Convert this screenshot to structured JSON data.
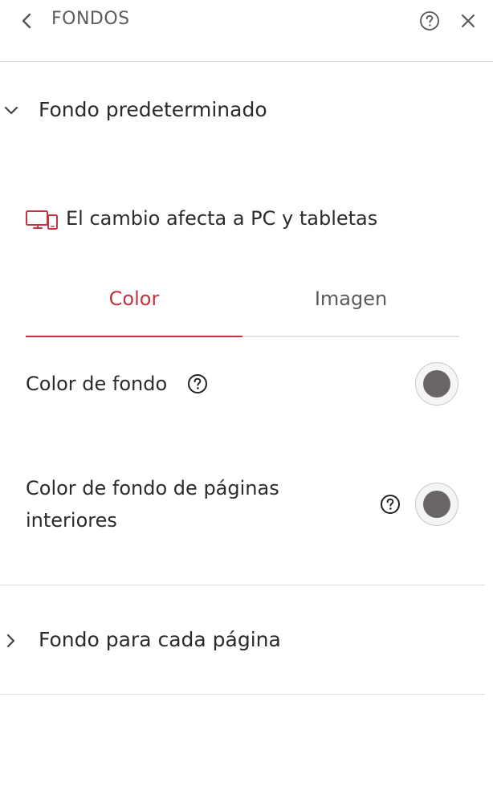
{
  "header": {
    "title": "FONDOS",
    "back_icon": "chevron-left-icon",
    "help_icon": "question-circle-icon",
    "close_icon": "close-icon"
  },
  "sections": [
    {
      "label": "Fondo predeterminado",
      "expanded": true,
      "device_note": "El cambio afecta a PC y tabletas",
      "tabs": [
        {
          "label": "Color",
          "active": true
        },
        {
          "label": "Imagen",
          "active": false
        }
      ],
      "settings": [
        {
          "label": "Color de fondo",
          "color": "#6b6464"
        },
        {
          "label": "Color de fondo de páginas interiores",
          "color": "#6b6464"
        }
      ]
    },
    {
      "label": "Fondo para cada página",
      "expanded": false
    }
  ],
  "colors": {
    "accent": "#c7323f",
    "divider": "#d9d9d9",
    "swatch_fill": "#6b6464"
  }
}
